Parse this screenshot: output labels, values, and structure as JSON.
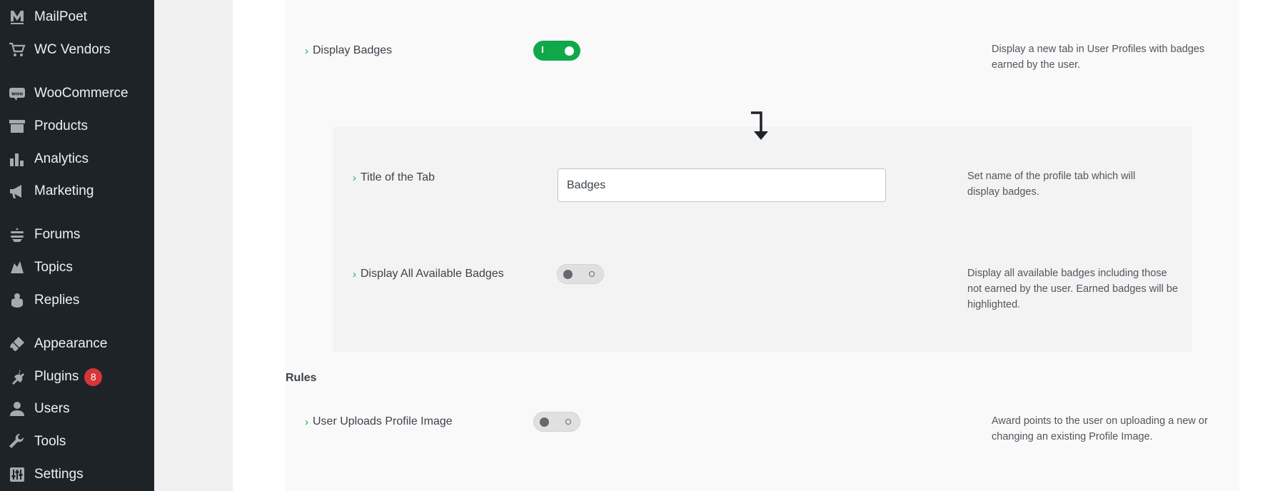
{
  "sidebar": {
    "items": [
      {
        "label": "MailPoet",
        "icon": "mailpoet-icon"
      },
      {
        "label": "WC Vendors",
        "icon": "cart-icon"
      },
      {
        "label": "WooCommerce",
        "icon": "woo-icon"
      },
      {
        "label": "Products",
        "icon": "archive-icon"
      },
      {
        "label": "Analytics",
        "icon": "bar-chart-icon"
      },
      {
        "label": "Marketing",
        "icon": "megaphone-icon"
      },
      {
        "label": "Forums",
        "icon": "forums-icon"
      },
      {
        "label": "Topics",
        "icon": "topics-icon"
      },
      {
        "label": "Replies",
        "icon": "replies-icon"
      },
      {
        "label": "Appearance",
        "icon": "paintbrush-icon"
      },
      {
        "label": "Plugins",
        "icon": "plugin-icon",
        "badge": "8"
      },
      {
        "label": "Users",
        "icon": "user-icon"
      },
      {
        "label": "Tools",
        "icon": "wrench-icon"
      },
      {
        "label": "Settings",
        "icon": "settings-icon"
      }
    ]
  },
  "settings": {
    "display_badges": {
      "label": "Display Badges",
      "enabled": true,
      "description": "Display a new tab in User Profiles with badges earned by the user."
    },
    "tab_title": {
      "label": "Title of the Tab",
      "value": "Badges",
      "description": "Set name of the profile tab which will display badges."
    },
    "display_all_badges": {
      "label": "Display All Available Badges",
      "enabled": false,
      "description": "Display all available badges including those not earned by the user. Earned badges will be highlighted."
    },
    "rules_title": "Rules",
    "profile_image": {
      "label": "User Uploads Profile Image",
      "enabled": false,
      "description": "Award points to the user on uploading a new or changing an existing Profile Image."
    }
  },
  "colors": {
    "sidebar_bg": "#1d2327",
    "toggle_on": "#10a84a",
    "accent_chevron": "#1eaa4d",
    "badge_red": "#d63638"
  }
}
